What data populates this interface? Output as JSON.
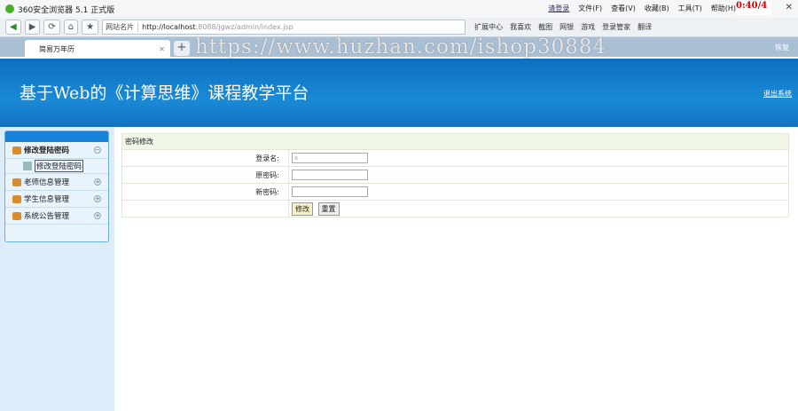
{
  "browser": {
    "title": "360安全浏览器 5.1 正式版",
    "login": "请登录",
    "menus": [
      "文件(F)",
      "查看(V)",
      "收藏(B)",
      "工具(T)",
      "帮助(H)"
    ],
    "timer": "0:40/4",
    "site_card": "网站名片",
    "url_host": "http://localhost",
    "url_rest": ":8088/jgwz/admin/index.jsp",
    "tools": [
      "扩展中心",
      "我喜欢",
      "截图",
      "网银",
      "游戏",
      "登录管家",
      "翻译"
    ],
    "tab": "简易万年历",
    "restore": "恢复"
  },
  "watermark": "https://www.huzhan.com/ishop30884",
  "header": {
    "title": "基于Web的《计算思维》课程教学平台",
    "logout": "退出系统"
  },
  "sidebar": {
    "items": [
      {
        "label": "修改登陆密码",
        "toggle": "−",
        "sub": "修改登陆密码"
      },
      {
        "label": "老师信息管理",
        "toggle": "+"
      },
      {
        "label": "学生信息管理",
        "toggle": "+"
      },
      {
        "label": "系统公告管理",
        "toggle": "+"
      }
    ]
  },
  "form": {
    "title": "密码修改",
    "login_label": "登录名:",
    "login_value": "a",
    "old_label": "原密码:",
    "new_label": "新密码:",
    "submit": "修改",
    "reset": "重置"
  }
}
